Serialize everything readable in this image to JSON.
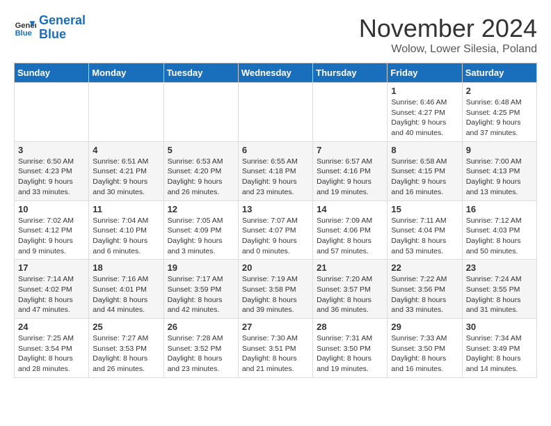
{
  "logo": {
    "line1": "General",
    "line2": "Blue"
  },
  "title": "November 2024",
  "location": "Wolow, Lower Silesia, Poland",
  "days_of_week": [
    "Sunday",
    "Monday",
    "Tuesday",
    "Wednesday",
    "Thursday",
    "Friday",
    "Saturday"
  ],
  "weeks": [
    {
      "alt": false,
      "days": [
        {
          "num": "",
          "info": ""
        },
        {
          "num": "",
          "info": ""
        },
        {
          "num": "",
          "info": ""
        },
        {
          "num": "",
          "info": ""
        },
        {
          "num": "",
          "info": ""
        },
        {
          "num": "1",
          "info": "Sunrise: 6:46 AM\nSunset: 4:27 PM\nDaylight: 9 hours and 40 minutes."
        },
        {
          "num": "2",
          "info": "Sunrise: 6:48 AM\nSunset: 4:25 PM\nDaylight: 9 hours and 37 minutes."
        }
      ]
    },
    {
      "alt": true,
      "days": [
        {
          "num": "3",
          "info": "Sunrise: 6:50 AM\nSunset: 4:23 PM\nDaylight: 9 hours and 33 minutes."
        },
        {
          "num": "4",
          "info": "Sunrise: 6:51 AM\nSunset: 4:21 PM\nDaylight: 9 hours and 30 minutes."
        },
        {
          "num": "5",
          "info": "Sunrise: 6:53 AM\nSunset: 4:20 PM\nDaylight: 9 hours and 26 minutes."
        },
        {
          "num": "6",
          "info": "Sunrise: 6:55 AM\nSunset: 4:18 PM\nDaylight: 9 hours and 23 minutes."
        },
        {
          "num": "7",
          "info": "Sunrise: 6:57 AM\nSunset: 4:16 PM\nDaylight: 9 hours and 19 minutes."
        },
        {
          "num": "8",
          "info": "Sunrise: 6:58 AM\nSunset: 4:15 PM\nDaylight: 9 hours and 16 minutes."
        },
        {
          "num": "9",
          "info": "Sunrise: 7:00 AM\nSunset: 4:13 PM\nDaylight: 9 hours and 13 minutes."
        }
      ]
    },
    {
      "alt": false,
      "days": [
        {
          "num": "10",
          "info": "Sunrise: 7:02 AM\nSunset: 4:12 PM\nDaylight: 9 hours and 9 minutes."
        },
        {
          "num": "11",
          "info": "Sunrise: 7:04 AM\nSunset: 4:10 PM\nDaylight: 9 hours and 6 minutes."
        },
        {
          "num": "12",
          "info": "Sunrise: 7:05 AM\nSunset: 4:09 PM\nDaylight: 9 hours and 3 minutes."
        },
        {
          "num": "13",
          "info": "Sunrise: 7:07 AM\nSunset: 4:07 PM\nDaylight: 9 hours and 0 minutes."
        },
        {
          "num": "14",
          "info": "Sunrise: 7:09 AM\nSunset: 4:06 PM\nDaylight: 8 hours and 57 minutes."
        },
        {
          "num": "15",
          "info": "Sunrise: 7:11 AM\nSunset: 4:04 PM\nDaylight: 8 hours and 53 minutes."
        },
        {
          "num": "16",
          "info": "Sunrise: 7:12 AM\nSunset: 4:03 PM\nDaylight: 8 hours and 50 minutes."
        }
      ]
    },
    {
      "alt": true,
      "days": [
        {
          "num": "17",
          "info": "Sunrise: 7:14 AM\nSunset: 4:02 PM\nDaylight: 8 hours and 47 minutes."
        },
        {
          "num": "18",
          "info": "Sunrise: 7:16 AM\nSunset: 4:01 PM\nDaylight: 8 hours and 44 minutes."
        },
        {
          "num": "19",
          "info": "Sunrise: 7:17 AM\nSunset: 3:59 PM\nDaylight: 8 hours and 42 minutes."
        },
        {
          "num": "20",
          "info": "Sunrise: 7:19 AM\nSunset: 3:58 PM\nDaylight: 8 hours and 39 minutes."
        },
        {
          "num": "21",
          "info": "Sunrise: 7:20 AM\nSunset: 3:57 PM\nDaylight: 8 hours and 36 minutes."
        },
        {
          "num": "22",
          "info": "Sunrise: 7:22 AM\nSunset: 3:56 PM\nDaylight: 8 hours and 33 minutes."
        },
        {
          "num": "23",
          "info": "Sunrise: 7:24 AM\nSunset: 3:55 PM\nDaylight: 8 hours and 31 minutes."
        }
      ]
    },
    {
      "alt": false,
      "days": [
        {
          "num": "24",
          "info": "Sunrise: 7:25 AM\nSunset: 3:54 PM\nDaylight: 8 hours and 28 minutes."
        },
        {
          "num": "25",
          "info": "Sunrise: 7:27 AM\nSunset: 3:53 PM\nDaylight: 8 hours and 26 minutes."
        },
        {
          "num": "26",
          "info": "Sunrise: 7:28 AM\nSunset: 3:52 PM\nDaylight: 8 hours and 23 minutes."
        },
        {
          "num": "27",
          "info": "Sunrise: 7:30 AM\nSunset: 3:51 PM\nDaylight: 8 hours and 21 minutes."
        },
        {
          "num": "28",
          "info": "Sunrise: 7:31 AM\nSunset: 3:50 PM\nDaylight: 8 hours and 19 minutes."
        },
        {
          "num": "29",
          "info": "Sunrise: 7:33 AM\nSunset: 3:50 PM\nDaylight: 8 hours and 16 minutes."
        },
        {
          "num": "30",
          "info": "Sunrise: 7:34 AM\nSunset: 3:49 PM\nDaylight: 8 hours and 14 minutes."
        }
      ]
    }
  ]
}
